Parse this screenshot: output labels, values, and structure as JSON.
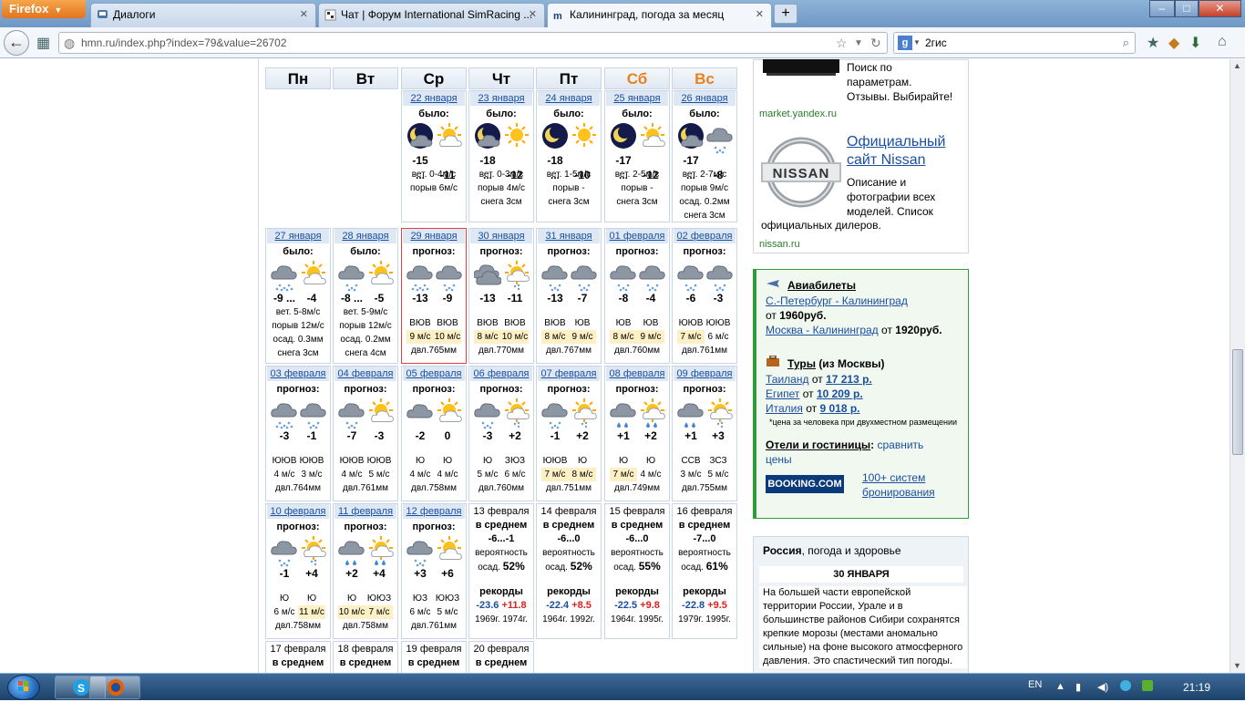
{
  "browser": {
    "menu_button": "Firefox",
    "tabs": [
      {
        "label": "Диалоги",
        "icon": "chat-icon"
      },
      {
        "label": "Чат | Форум International SimRacing ...",
        "icon": "forum-icon"
      },
      {
        "label": "Калининград, погода за месяц",
        "icon": "hmn-icon",
        "active": true
      }
    ],
    "new_tab": "+",
    "url": "hmn.ru/index.php?index=79&value=26702",
    "search_engine": "Google",
    "search_text": "2гис",
    "window_controls": [
      "–",
      "□",
      "✕"
    ]
  },
  "calendar": {
    "weekdays": [
      "Пн",
      "Вт",
      "Ср",
      "Чт",
      "Пт",
      "Сб",
      "Вс"
    ],
    "weekend_color": "#e8821a",
    "label_past": "было:",
    "label_forecast": "прогноз:",
    "rows": [
      [
        null,
        null,
        {
          "date": "22 января",
          "kind": "past",
          "day": "moon-cloud",
          "night": "sun-cloud",
          "t1": "-15 ...",
          "t2": "-11",
          "lines": [
            "вет. 0-4м/с",
            "порыв 6м/с"
          ]
        },
        {
          "date": "23 января",
          "kind": "past",
          "day": "moon-cloud",
          "night": "sun",
          "t1": "-18 ...",
          "t2": "-12",
          "lines": [
            "вет. 0-3м/с",
            "порыв 4м/с",
            "снега 3см"
          ]
        },
        {
          "date": "24 января",
          "kind": "past",
          "day": "moon",
          "night": "sun",
          "t1": "-18 ...",
          "t2": "-10",
          "lines": [
            "вет. 1-5м/с",
            "порыв -",
            "снега 3см"
          ]
        },
        {
          "date": "25 января",
          "kind": "past",
          "day": "moon",
          "night": "sun-cloud",
          "t1": "-17 ...",
          "t2": "-12",
          "lines": [
            "вет. 2-5м/с",
            "порыв -",
            "снега 3см"
          ]
        },
        {
          "date": "26 января",
          "kind": "past",
          "day": "moon-cloud",
          "night": "snow",
          "t1": "-17 ...",
          "t2": "-8",
          "lines": [
            "вет. 2-7м/с",
            "порыв 9м/с",
            "осад. 0.2мм",
            "снега 3см"
          ]
        }
      ],
      [
        {
          "date": "27 января",
          "kind": "past",
          "day": "snow-heavy",
          "night": "sun-cloud",
          "t1": "-9 ...",
          "t2": "-4",
          "lines": [
            "вет. 5-8м/с",
            "порыв 12м/с",
            "осад. 0.3мм",
            "снега 3см"
          ]
        },
        {
          "date": "28 января",
          "kind": "past",
          "day": "snow",
          "night": "sun-cloud",
          "t1": "-8 ...",
          "t2": "-5",
          "lines": [
            "вет. 5-9м/с",
            "порыв 12м/с",
            "осад. 0.2мм",
            "снега 4см"
          ]
        },
        {
          "date": "29 января",
          "kind": "forecast",
          "today": true,
          "day": "snow-heavy",
          "night": "snow",
          "t1": "-13",
          "t2": "-9",
          "w1": "ВЮВ",
          "w2": "ВЮВ",
          "s1": "9 м/с",
          "s2": "10 м/с",
          "h1": true,
          "h2": true,
          "press": "двл.765мм"
        },
        {
          "date": "30 января",
          "kind": "forecast",
          "day": "cloud-dark",
          "night": "sun-snow",
          "t1": "-13",
          "t2": "-11",
          "w1": "ВЮВ",
          "w2": "ВЮВ",
          "s1": "8 м/с",
          "s2": "10 м/с",
          "h1": true,
          "h2": true,
          "press": "двл.770мм"
        },
        {
          "date": "31 января",
          "kind": "forecast",
          "day": "snow",
          "night": "snow",
          "t1": "-13",
          "t2": "-7",
          "w1": "ВЮВ",
          "w2": "ЮВ",
          "s1": "8 м/с",
          "s2": "9 м/с",
          "h1": true,
          "h2": true,
          "press": "двл.767мм"
        },
        {
          "date": "01 февраля",
          "kind": "forecast",
          "day": "snow",
          "night": "snow",
          "t1": "-8",
          "t2": "-4",
          "w1": "ЮВ",
          "w2": "ЮВ",
          "s1": "8 м/с",
          "s2": "9 м/с",
          "h1": true,
          "h2": true,
          "press": "двл.760мм"
        },
        {
          "date": "02 февраля",
          "kind": "forecast",
          "day": "snow",
          "night": "snow",
          "t1": "-6",
          "t2": "-3",
          "w1": "ЮЮВ",
          "w2": "ЮЮВ",
          "s1": "7 м/с",
          "s2": "6 м/с",
          "h1": true,
          "h2": false,
          "press": "двл.761мм"
        }
      ],
      [
        {
          "date": "03 февраля",
          "kind": "forecast",
          "day": "snow-heavy",
          "night": "snow",
          "t1": "-3",
          "t2": "-1",
          "w1": "ЮЮВ",
          "w2": "ЮЮВ",
          "s1": "4 м/с",
          "s2": "3 м/с",
          "h1": false,
          "h2": false,
          "press": "двл.764мм"
        },
        {
          "date": "04 февраля",
          "kind": "forecast",
          "day": "snow",
          "night": "sun-cloud",
          "t1": "-7",
          "t2": "-3",
          "w1": "ЮЮВ",
          "w2": "ЮЮВ",
          "s1": "4 м/с",
          "s2": "5 м/с",
          "h1": false,
          "h2": false,
          "press": "двл.761мм"
        },
        {
          "date": "05 февраля",
          "kind": "forecast",
          "day": "cloud",
          "night": "sun-cloud",
          "t1": "-2",
          "t2": "0",
          "w1": "Ю",
          "w2": "Ю",
          "s1": "4 м/с",
          "s2": "4 м/с",
          "h1": false,
          "h2": false,
          "press": "двл.758мм"
        },
        {
          "date": "06 февраля",
          "kind": "forecast",
          "day": "snow",
          "night": "sun-snow",
          "t1": "-3",
          "t2": "+2",
          "w1": "Ю",
          "w2": "ЗЮЗ",
          "s1": "5 м/с",
          "s2": "6 м/с",
          "h1": false,
          "h2": false,
          "press": "двл.760мм"
        },
        {
          "date": "07 февраля",
          "kind": "forecast",
          "day": "snow",
          "night": "sun-snow",
          "t1": "-1",
          "t2": "+2",
          "w1": "ЮЮВ",
          "w2": "Ю",
          "s1": "7 м/с",
          "s2": "8 м/с",
          "h1": true,
          "h2": true,
          "press": "двл.751мм"
        },
        {
          "date": "08 февраля",
          "kind": "forecast",
          "day": "rain",
          "night": "sun-rain",
          "t1": "+1",
          "t2": "+2",
          "w1": "Ю",
          "w2": "Ю",
          "s1": "7 м/с",
          "s2": "4 м/с",
          "h1": true,
          "h2": false,
          "press": "двл.749мм"
        },
        {
          "date": "09 февраля",
          "kind": "forecast",
          "day": "rain",
          "night": "sun-snow",
          "t1": "+1",
          "t2": "+3",
          "w1": "ССВ",
          "w2": "ЗСЗ",
          "s1": "3 м/с",
          "s2": "5 м/с",
          "h1": false,
          "h2": false,
          "press": "двл.755мм"
        }
      ],
      [
        {
          "date": "10 февраля",
          "kind": "forecast",
          "day": "snow",
          "night": "sun-snow",
          "t1": "-1",
          "t2": "+4",
          "w1": "Ю",
          "w2": "Ю",
          "s1": "6 м/с",
          "s2": "11 м/с",
          "h1": false,
          "h2": true,
          "press": "двл.758мм"
        },
        {
          "date": "11 февраля",
          "kind": "forecast",
          "day": "rain",
          "night": "sun-rain",
          "t1": "+2",
          "t2": "+4",
          "w1": "Ю",
          "w2": "ЮЮЗ",
          "s1": "10 м/с",
          "s2": "7 м/с",
          "h1": true,
          "h2": true,
          "press": "двл.758мм"
        },
        {
          "date": "12 февраля",
          "kind": "forecast",
          "day": "snow",
          "night": "sun-cloud",
          "t1": "+3",
          "t2": "+6",
          "w1": "ЮЗ",
          "w2": "ЮЮЗ",
          "s1": "6 м/с",
          "s2": "5 м/с",
          "h1": false,
          "h2": false,
          "press": "двл.761мм"
        },
        {
          "date": "13 февраля",
          "kind": "avg",
          "avg_label": "в среднем",
          "avg": "-6...-1",
          "prob": "вероятность",
          "osad": "осад.",
          "pct": "52%",
          "rec_label": "рекорды",
          "rmin": "-23.6",
          "rmax": "+11.8",
          "ymin": "1969г.",
          "ymax": "1974г."
        },
        {
          "date": "14 февраля",
          "kind": "avg",
          "avg_label": "в среднем",
          "avg": "-6...0",
          "prob": "вероятность",
          "osad": "осад.",
          "pct": "52%",
          "rec_label": "рекорды",
          "rmin": "-22.4",
          "rmax": "+8.5",
          "ymin": "1964г.",
          "ymax": "1992г."
        },
        {
          "date": "15 февраля",
          "kind": "avg",
          "avg_label": "в среднем",
          "avg": "-6...0",
          "prob": "вероятность",
          "osad": "осад.",
          "pct": "55%",
          "rec_label": "рекорды",
          "rmin": "-22.5",
          "rmax": "+9.8",
          "ymin": "1964г.",
          "ymax": "1995г."
        },
        {
          "date": "16 февраля",
          "kind": "avg",
          "avg_label": "в среднем",
          "avg": "-7...0",
          "prob": "вероятность",
          "osad": "осад.",
          "pct": "61%",
          "rec_label": "рекорды",
          "rmin": "-22.8",
          "rmax": "+9.5",
          "ymin": "1979г.",
          "ymax": "1995г."
        }
      ],
      [
        {
          "date": "17 февраля",
          "kind": "avg-cut",
          "avg_label": "в среднем"
        },
        {
          "date": "18 февраля",
          "kind": "avg-cut",
          "avg_label": "в среднем"
        },
        {
          "date": "19 февраля",
          "kind": "avg-cut",
          "avg_label": "в среднем"
        },
        {
          "date": "20 февраля",
          "kind": "avg-cut",
          "avg_label": "в среднем"
        },
        null,
        null,
        null
      ]
    ]
  },
  "ads": {
    "market": {
      "text": [
        "Поиск по",
        "параметрам.",
        "Отзывы. Выбирайте!"
      ],
      "source": "market.yandex.ru"
    },
    "nissan": {
      "logo": "NISSAN",
      "title1": "Официальный",
      "title2": "сайт Nissan",
      "desc": [
        "Описание и",
        "фотографии всех",
        "моделей. Список"
      ],
      "desc_full": "официальных дилеров.",
      "source": "nissan.ru"
    },
    "travel": {
      "avia_title": "Авиабилеты",
      "route1": "С.-Петербург - Калининград",
      "route1_pre": "от",
      "route1_price": "1960руб.",
      "route2": "Москва - Калининград",
      "route2_pre": "от",
      "route2_price": "1920руб.",
      "tours_title": "Туры",
      "tours_sub": "(из Москвы)",
      "tours": [
        {
          "country": "Таиланд",
          "pre": "от",
          "price": "17 213 р."
        },
        {
          "country": "Египет",
          "pre": "от",
          "price": "10 209 р."
        },
        {
          "country": "Италия",
          "pre": "от",
          "price": "9 018 р."
        }
      ],
      "note": "*цена за человека при двухместном размещении",
      "hotels_title": "Отели и гостиницы",
      "hotels_sep": ":",
      "hotels_link": "сравнить",
      "hotels_link2": "цены",
      "booking_logo": "BOOKING.COM",
      "booking_link1": "100+ систем",
      "booking_link2": "бронирования"
    },
    "health": {
      "header_bold": "Россия",
      "header_rest": ", погода и здоровье",
      "date": "30 ЯНВАРЯ",
      "lines": [
        "На большей части европейской",
        "территории России, Урале и в",
        "большинстве районов Сибири сохранятся",
        "крепкие морозы (местами аномально",
        "сильные) на фоне высокого атмосферного",
        "давления. Это спастический тип погоды."
      ]
    }
  },
  "taskbar": {
    "lang": "EN",
    "time": "21:19"
  }
}
